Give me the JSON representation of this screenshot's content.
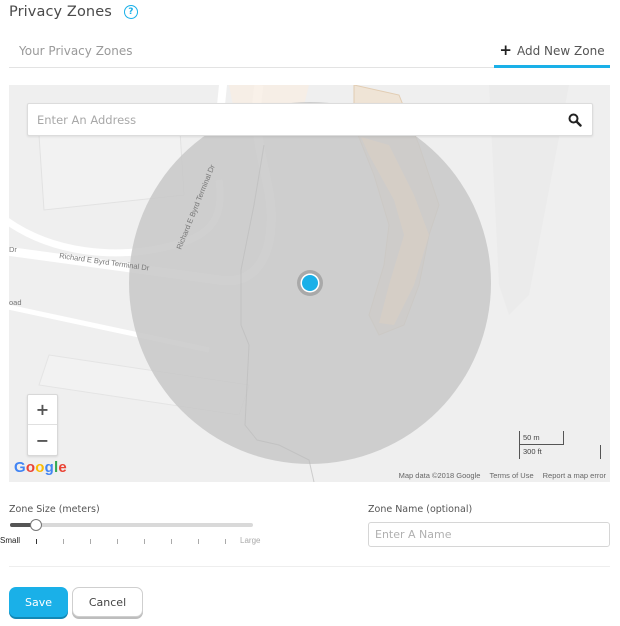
{
  "header": {
    "title": "Privacy Zones",
    "help_icon": "help-circle-icon"
  },
  "tabs": {
    "your_zones_label": "Your Privacy Zones",
    "add_zone_label": "Add New Zone",
    "add_zone_icon": "plus-icon",
    "active_tab": "Add New Zone"
  },
  "map": {
    "search_placeholder": "Enter An Address",
    "search_value": "",
    "search_icon": "search-icon",
    "zoom_in_label": "+",
    "zoom_out_label": "−",
    "street_labels": [
      "Richard E Byrd Terminal Dr",
      "Richard E Byrd Terminal Dr",
      "Dr",
      "oad"
    ],
    "provider_logo": "Google",
    "scale_metric": "50 m",
    "scale_imperial": "300 ft",
    "attribution": [
      "Map data ©2018 Google",
      "Terms of Use",
      "Report a map error"
    ],
    "colors": {
      "zone_fill": "#c8c8c8",
      "marker": "#1ab0e8",
      "background": "#efefef"
    }
  },
  "zone_size": {
    "label": "Zone Size (meters)",
    "min_label": "Small",
    "max_label": "Large",
    "tick_count": 8,
    "selected_index": 0
  },
  "zone_name": {
    "label": "Zone Name (optional)",
    "placeholder": "Enter A Name",
    "value": ""
  },
  "actions": {
    "save_label": "Save",
    "cancel_label": "Cancel"
  },
  "theme": {
    "accent": "#1ab0e8"
  }
}
